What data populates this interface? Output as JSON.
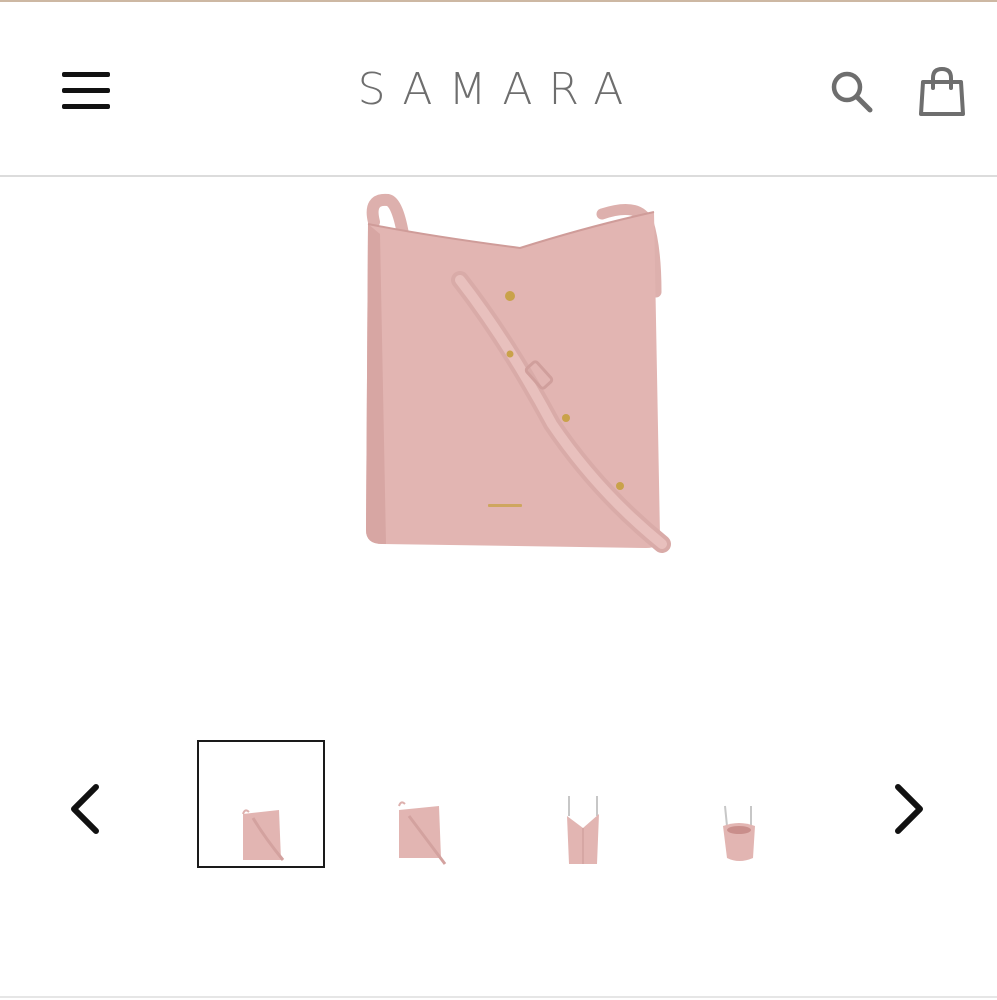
{
  "header": {
    "brand": "SAMARA",
    "menu_icon": "hamburger-menu-icon",
    "search_icon": "search-icon",
    "cart_icon": "shopping-bag-icon"
  },
  "product": {
    "image": "pink-crossbody-bucket-bag",
    "color": "#e2b5b2",
    "accent_hardware": "#c9a24a"
  },
  "gallery": {
    "prev_icon": "chevron-left-icon",
    "next_icon": "chevron-right-icon",
    "thumbnails": [
      {
        "view": "front",
        "selected": true
      },
      {
        "view": "front-strap",
        "selected": false
      },
      {
        "view": "side",
        "selected": false
      },
      {
        "view": "top-open",
        "selected": false
      }
    ]
  },
  "colors": {
    "brand_text": "#6e6e6e",
    "top_strip": "#cdb8a3",
    "divider": "#dcdcdc"
  }
}
